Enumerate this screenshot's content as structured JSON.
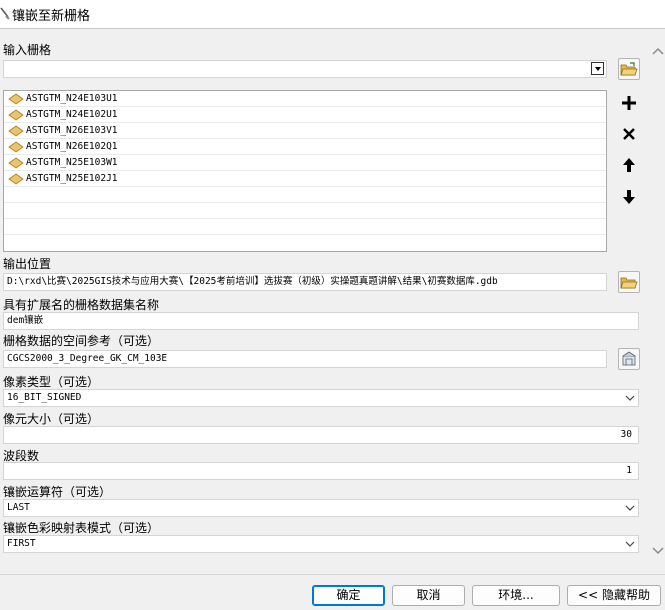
{
  "window": {
    "title": "镶嵌至新栅格"
  },
  "input_rasters": {
    "label": "输入栅格",
    "value": "",
    "items": [
      "ASTGTM_N24E103U1",
      "ASTGTM_N24E102U1",
      "ASTGTM_N26E103V1",
      "ASTGTM_N26E102Q1",
      "ASTGTM_N25E103W1",
      "ASTGTM_N25E102J1"
    ]
  },
  "output_location": {
    "label": "输出位置",
    "value": "D:\\rxd\\比赛\\2025GIS技术与应用大赛\\【2025考前培训】选拔赛（初级）实操题真题讲解\\结果\\初赛数据库.gdb"
  },
  "dataset_name": {
    "label": "具有扩展名的栅格数据集名称",
    "value": "dem镶嵌"
  },
  "spatial_reference": {
    "label": "栅格数据的空间参考（可选）",
    "value": "CGCS2000_3_Degree_GK_CM_103E"
  },
  "pixel_type": {
    "label": "像素类型（可选）",
    "value": "16_BIT_SIGNED"
  },
  "cellsize": {
    "label": "像元大小（可选）",
    "value": "30"
  },
  "bands": {
    "label": "波段数",
    "value": "1"
  },
  "mosaic_operator": {
    "label": "镶嵌运算符（可选）",
    "value": "LAST"
  },
  "colormap_mode": {
    "label": "镶嵌色彩映射表模式（可选）",
    "value": "FIRST"
  },
  "buttons": {
    "ok": "确定",
    "cancel": "取消",
    "env": "环境...",
    "help": "<< 隐藏帮助"
  },
  "colors": {
    "accent": "#0078d7",
    "folder": "#e8b84a",
    "raster_icon": "#e9c46a"
  }
}
